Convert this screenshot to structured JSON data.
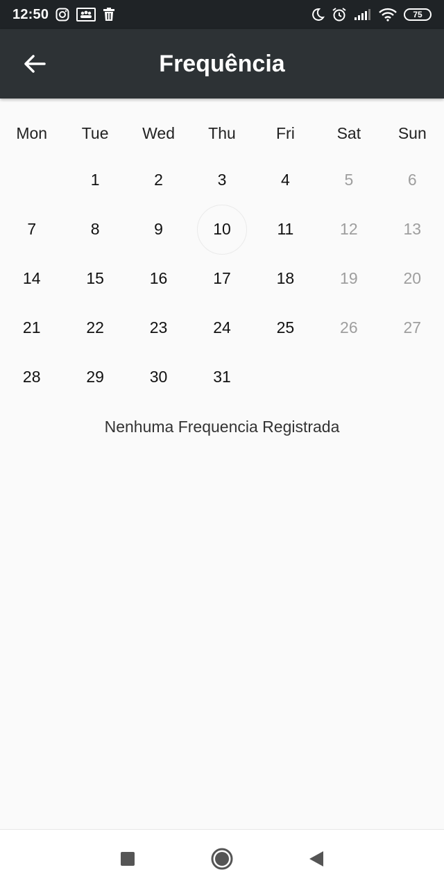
{
  "status_bar": {
    "time": "12:50",
    "battery": "75",
    "left_icons": [
      "instagram-icon",
      "group-notification-icon",
      "trash-icon"
    ],
    "right_icons": [
      "moon-icon",
      "alarm-icon",
      "signal-icon",
      "wifi-icon",
      "battery-icon"
    ]
  },
  "app_bar": {
    "title": "Frequência",
    "background": "#2d3235"
  },
  "calendar": {
    "weekdays": [
      "Mon",
      "Tue",
      "Wed",
      "Thu",
      "Fri",
      "Sat",
      "Sun"
    ],
    "weeks": [
      [
        "",
        "1",
        "2",
        "3",
        "4",
        "5",
        "6"
      ],
      [
        "7",
        "8",
        "9",
        "10",
        "11",
        "12",
        "13"
      ],
      [
        "14",
        "15",
        "16",
        "17",
        "18",
        "19",
        "20"
      ],
      [
        "21",
        "22",
        "23",
        "24",
        "25",
        "26",
        "27"
      ],
      [
        "28",
        "29",
        "30",
        "31",
        "",
        "",
        ""
      ]
    ],
    "today": "10",
    "weekend_color": "#9e9e9e"
  },
  "empty_message": "Nenhuma Frequencia Registrada",
  "nav_bar": {
    "buttons": [
      "recent-apps-icon",
      "home-icon",
      "back-nav-icon"
    ]
  }
}
